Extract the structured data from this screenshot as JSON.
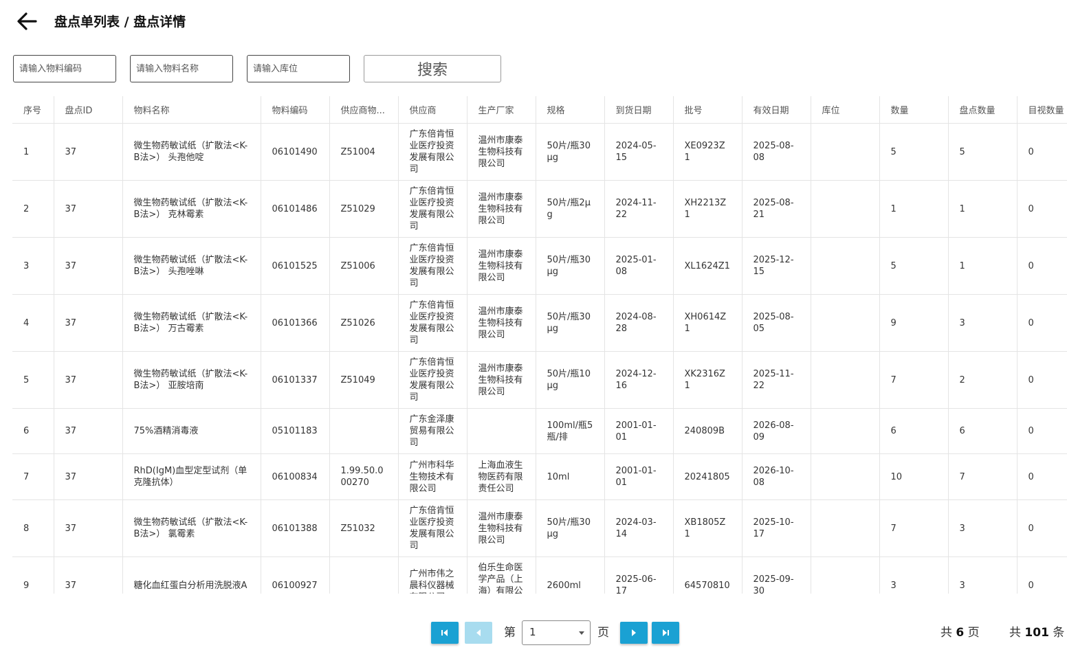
{
  "header": {
    "title": "盘点单列表 / 盘点详情"
  },
  "filters": {
    "material_code_placeholder": "请输入物料编码",
    "material_name_placeholder": "请输入物料名称",
    "location_placeholder": "请输入库位",
    "search_label": "搜索"
  },
  "table": {
    "columns": [
      "序号",
      "盘点ID",
      "物料名称",
      "物料编码",
      "供应商物...",
      "供应商",
      "生产厂家",
      "规格",
      "到货日期",
      "批号",
      "有效日期",
      "库位",
      "数量",
      "盘点数量",
      "目视数量"
    ],
    "rows": [
      [
        "1",
        "37",
        "微生物药敏试纸（扩散法<K-B法>） 头孢他啶",
        "06101490",
        "Z51004",
        "广东倍肯恒业医疗投资发展有限公司",
        "温州市康泰生物科技有限公司",
        "50片/瓶30μg",
        "2024-05-15",
        "XE0923Z1",
        "2025-08-08",
        "",
        "5",
        "5",
        "0"
      ],
      [
        "2",
        "37",
        "微生物药敏试纸（扩散法<K-B法>） 克林霉素",
        "06101486",
        "Z51029",
        "广东倍肯恒业医疗投资发展有限公司",
        "温州市康泰生物科技有限公司",
        "50片/瓶2μg",
        "2024-11-22",
        "XH2213Z1",
        "2025-08-21",
        "",
        "1",
        "1",
        "0"
      ],
      [
        "3",
        "37",
        "微生物药敏试纸（扩散法<K-B法>） 头孢唑啉",
        "06101525",
        "Z51006",
        "广东倍肯恒业医疗投资发展有限公司",
        "温州市康泰生物科技有限公司",
        "50片/瓶30μg",
        "2025-01-08",
        "XL1624Z1",
        "2025-12-15",
        "",
        "5",
        "1",
        "0"
      ],
      [
        "4",
        "37",
        "微生物药敏试纸（扩散法<K-B法>） 万古霉素",
        "06101366",
        "Z51026",
        "广东倍肯恒业医疗投资发展有限公司",
        "温州市康泰生物科技有限公司",
        "50片/瓶30μg",
        "2024-08-28",
        "XH0614Z1",
        "2025-08-05",
        "",
        "9",
        "3",
        "0"
      ],
      [
        "5",
        "37",
        "微生物药敏试纸（扩散法<K-B法>） 亚胺培南",
        "06101337",
        "Z51049",
        "广东倍肯恒业医疗投资发展有限公司",
        "温州市康泰生物科技有限公司",
        "50片/瓶10μg",
        "2024-12-16",
        "XK2316Z1",
        "2025-11-22",
        "",
        "7",
        "2",
        "0"
      ],
      [
        "6",
        "37",
        "75%酒精消毒液",
        "05101183",
        "",
        "广东金泽康贸易有限公司",
        "",
        "100ml/瓶5瓶/排",
        "2001-01-01",
        "240809B",
        "2026-08-09",
        "",
        "6",
        "6",
        "0"
      ],
      [
        "7",
        "37",
        "RhD(IgM)血型定型试剂（单克隆抗体）",
        "06100834",
        "1.99.50.000270",
        "广州市科华生物技术有限公司",
        "上海血液生物医药有限责任公司",
        "10ml",
        "2001-01-01",
        "20241805",
        "2026-10-08",
        "",
        "10",
        "7",
        "0"
      ],
      [
        "8",
        "37",
        "微生物药敏试纸（扩散法<K-B法>） 氯霉素",
        "06101388",
        "Z51032",
        "广东倍肯恒业医疗投资发展有限公司",
        "温州市康泰生物科技有限公司",
        "50片/瓶30μg",
        "2024-03-14",
        "XB1805Z1",
        "2025-10-17",
        "",
        "7",
        "3",
        "0"
      ],
      [
        "9",
        "37",
        "糖化血红蛋白分析用洗脱液A",
        "06100927",
        "",
        "广州市伟之晨科仪器械有限公司",
        "伯乐生命医学产品（上海）有限公司",
        "2600ml",
        "2025-06-17",
        "64570810",
        "2025-09-30",
        "",
        "3",
        "3",
        "0"
      ]
    ]
  },
  "pagination": {
    "prefix": "第",
    "current_page": "1",
    "suffix": "页",
    "total_pages_prefix": "共",
    "total_pages": "6",
    "total_pages_suffix": "页",
    "total_items_prefix": "共",
    "total_items": "101",
    "total_items_suffix": "条"
  },
  "colors": {
    "accent": "#1aa1d3",
    "accent_disabled": "#a8dcef",
    "border": "#e4e4e4"
  },
  "icons": {
    "back": "arrow-left-icon",
    "first": "first-page-icon",
    "prev": "prev-page-icon",
    "next": "next-page-icon",
    "last": "last-page-icon"
  }
}
